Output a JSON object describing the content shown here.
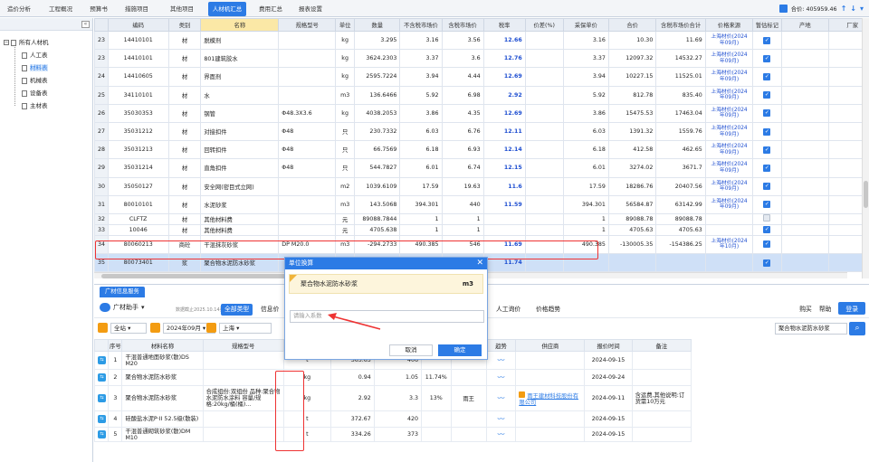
{
  "top_tabs": [
    "造价分析",
    "工程概况",
    "预算书",
    "措施项目",
    "其他项目",
    "人材机汇总",
    "费用汇总",
    "报表设置"
  ],
  "top_right": {
    "total_label": "合价: 405959.46"
  },
  "left_tree": {
    "root": "所有人材机",
    "children": [
      "人工表",
      "材料表",
      "机械表",
      "设备表",
      "主材表"
    ]
  },
  "main_table": {
    "headers": [
      "",
      "编码",
      "类别",
      "名称",
      "规格型号",
      "单位",
      "数量",
      "不含税市场价",
      "含税市场价",
      "税率",
      "价差(%)",
      "采保单价",
      "合价",
      "含税市场价合计",
      "价格来源",
      "暂估标记",
      "产地",
      "厂家",
      "备"
    ],
    "rows": [
      {
        "no": "23",
        "code": "14410101",
        "type": "材",
        "name": "脱模剂",
        "spec": "",
        "unit": "kg",
        "qty": "3.295",
        "p1": "3.16",
        "p2": "3.56",
        "rate": "12.66",
        "pct": "",
        "p3": "3.16",
        "total": "10.30",
        "total2": "11.69",
        "src": "上海材价(2024年09月)",
        "chk": true
      },
      {
        "no": "23",
        "code": "14410101",
        "type": "材",
        "name": "801建筑胶水",
        "spec": "",
        "unit": "kg",
        "qty": "3624.2303",
        "p1": "3.37",
        "p2": "3.6",
        "rate": "12.76",
        "pct": "",
        "p3": "3.37",
        "total": "12097.32",
        "total2": "14532.27",
        "src": "上海材价(2024年09月)",
        "chk": true
      },
      {
        "no": "24",
        "code": "14410605",
        "type": "材",
        "name": "界面剂",
        "spec": "",
        "unit": "kg",
        "qty": "2595.7224",
        "p1": "3.94",
        "p2": "4.44",
        "rate": "12.69",
        "pct": "",
        "p3": "3.94",
        "total": "10227.15",
        "total2": "11525.01",
        "src": "上海材价(2024年09月)",
        "chk": true
      },
      {
        "no": "25",
        "code": "34110101",
        "type": "材",
        "name": "水",
        "spec": "",
        "unit": "m3",
        "qty": "136.6466",
        "p1": "5.92",
        "p2": "6.98",
        "rate": "2.92",
        "pct": "",
        "p3": "5.92",
        "total": "812.78",
        "total2": "835.40",
        "src": "上海材价(2024年09月)",
        "chk": true
      },
      {
        "no": "26",
        "code": "35030353",
        "type": "材",
        "name": "钢管",
        "spec": "Φ48.3X3.6",
        "unit": "kg",
        "qty": "4038.2053",
        "p1": "3.86",
        "p2": "4.35",
        "rate": "12.69",
        "pct": "",
        "p3": "3.86",
        "total": "15475.53",
        "total2": "17463.04",
        "src": "上海材价(2024年09月)",
        "chk": true
      },
      {
        "no": "27",
        "code": "35031212",
        "type": "材",
        "name": "对接扣件",
        "spec": "Φ48",
        "unit": "只",
        "qty": "230.7332",
        "p1": "6.03",
        "p2": "6.76",
        "rate": "12.11",
        "pct": "",
        "p3": "6.03",
        "total": "1391.32",
        "total2": "1559.76",
        "src": "上海材价(2024年09月)",
        "chk": true
      },
      {
        "no": "28",
        "code": "35031213",
        "type": "材",
        "name": "回转扣件",
        "spec": "Φ48",
        "unit": "只",
        "qty": "66.7569",
        "p1": "6.18",
        "p2": "6.93",
        "rate": "12.14",
        "pct": "",
        "p3": "6.18",
        "total": "412.58",
        "total2": "462.65",
        "src": "上海材价(2024年09月)",
        "chk": true
      },
      {
        "no": "29",
        "code": "35031214",
        "type": "材",
        "name": "直角扣件",
        "spec": "Φ48",
        "unit": "只",
        "qty": "544.7827",
        "p1": "6.01",
        "p2": "6.74",
        "rate": "12.15",
        "pct": "",
        "p3": "6.01",
        "total": "3274.02",
        "total2": "3671.7",
        "src": "上海材价(2024年09月)",
        "chk": true
      },
      {
        "no": "30",
        "code": "35050127",
        "type": "材",
        "name": "安全网(密目式立网)",
        "spec": "",
        "unit": "m2",
        "qty": "1039.6109",
        "p1": "17.59",
        "p2": "19.63",
        "rate": "11.6",
        "pct": "",
        "p3": "17.59",
        "total": "18286.76",
        "total2": "20407.56",
        "src": "上海材价(2024年09月)",
        "chk": true
      },
      {
        "no": "31",
        "code": "80010101",
        "type": "材",
        "name": "水泥砂浆",
        "spec": "",
        "unit": "m3",
        "qty": "143.5068",
        "p1": "394.301",
        "p2": "440",
        "rate": "11.59",
        "pct": "",
        "p3": "394.301",
        "total": "56584.87",
        "total2": "63142.99",
        "src": "上海材价(2024年09月)",
        "chk": true
      },
      {
        "no": "32",
        "code": "CLFTZ",
        "type": "材",
        "name": "其他材料费",
        "spec": "",
        "unit": "元",
        "qty": "89088.7844",
        "p1": "1",
        "p2": "1",
        "rate": "",
        "pct": "",
        "p3": "1",
        "total": "89088.78",
        "total2": "89088.78",
        "src": "",
        "chk": false
      },
      {
        "no": "33",
        "code": "10046",
        "type": "材",
        "name": "其他材料费",
        "spec": "",
        "unit": "元",
        "qty": "4705.638",
        "p1": "1",
        "p2": "1",
        "rate": "",
        "pct": "",
        "p3": "1",
        "total": "4705.63",
        "total2": "4705.63",
        "src": "",
        "chk": true
      },
      {
        "no": "34",
        "code": "80060213",
        "type": "商砼",
        "name": "干混抹灰砂浆",
        "spec": "DP M20.0",
        "unit": "m3",
        "qty": "-294.2733",
        "p1": "490.385",
        "p2": "546",
        "rate": "11.69",
        "pct": "",
        "p3": "490.385",
        "total": "-130005.35",
        "total2": "-154386.25",
        "src": "上海材价(2024年10月)",
        "chk": true
      },
      {
        "no": "35",
        "code": "80073401",
        "type": "浆",
        "name": "聚合物水泥防水砂浆",
        "spec": "",
        "unit": "m3",
        "qty": "143.5068",
        "p1": "",
        "p2": "",
        "rate": "11.74",
        "pct": "",
        "p3": "",
        "total": "",
        "total2": "",
        "src": "",
        "chk": true
      }
    ]
  },
  "bottom_panel": {
    "tab_label": "广材信息服务",
    "assist": "广材助手",
    "update_text": "数据截止2025.10.14更新",
    "subtabs": [
      "全部类型",
      "信息价",
      "市场价",
      "专业测定价",
      "企业材料库",
      "人工询价",
      "价格趋势"
    ],
    "right_menu": {
      "buy": "购买",
      "help": "帮助",
      "login": "登录"
    },
    "filter": {
      "city": "全站",
      "period": "2024年09月",
      "region": "上海"
    },
    "search_value": "聚合物水泥防水砂浆",
    "headers": [
      "序号",
      "材料名称",
      "规格型号",
      "单位",
      "不含税价",
      "含税价",
      "税率",
      "价格来源",
      "趋势",
      "供应商",
      "报价时间",
      "备注"
    ],
    "rows": [
      {
        "no": "1",
        "name": "干混普通地面砂浆(散)DS M20",
        "spec": "",
        "unit": "t",
        "p1": "363.63",
        "p2": "406",
        "rate": "",
        "src": "",
        "supplier": "",
        "time": "2024-09-15",
        "note": ""
      },
      {
        "no": "2",
        "name": "聚合物水泥防水砂浆",
        "spec": "",
        "unit": "kg",
        "p1": "0.94",
        "p2": "1.05",
        "rate": "11.74%",
        "src": "",
        "supplier": "",
        "time": "2024-09-24",
        "note": ""
      },
      {
        "no": "3",
        "name": "聚合物水泥防水砂浆",
        "spec": "合成组份:双组份 品种:聚合物水泥防水涂料 容量/规格:20kg/桶(桶)...",
        "unit": "kg",
        "p1": "2.92",
        "p2": "3.3",
        "rate": "13%",
        "src": "雨王",
        "supplier": "雨王建材科技股份有限公司",
        "time": "2024-09-11",
        "note": "含运费,其他说明:订货需10万元"
      },
      {
        "no": "4",
        "name": "硅酸盐水泥P·II 52.5级(散装)",
        "spec": "",
        "unit": "t",
        "p1": "372.67",
        "p2": "420",
        "rate": "",
        "src": "",
        "supplier": "",
        "time": "2024-09-15",
        "note": ""
      },
      {
        "no": "5",
        "name": "干混普通砌筑砂浆(散)DM M10",
        "spec": "",
        "unit": "t",
        "p1": "334.26",
        "p2": "373",
        "rate": "",
        "src": "",
        "supplier": "",
        "time": "2024-09-15",
        "note": ""
      }
    ]
  },
  "dialog": {
    "title": "单位换算",
    "material": "聚合物水泥防水砂浆",
    "unit": "m3",
    "placeholder": "请输入系数",
    "cancel": "取消",
    "ok": "确定"
  }
}
